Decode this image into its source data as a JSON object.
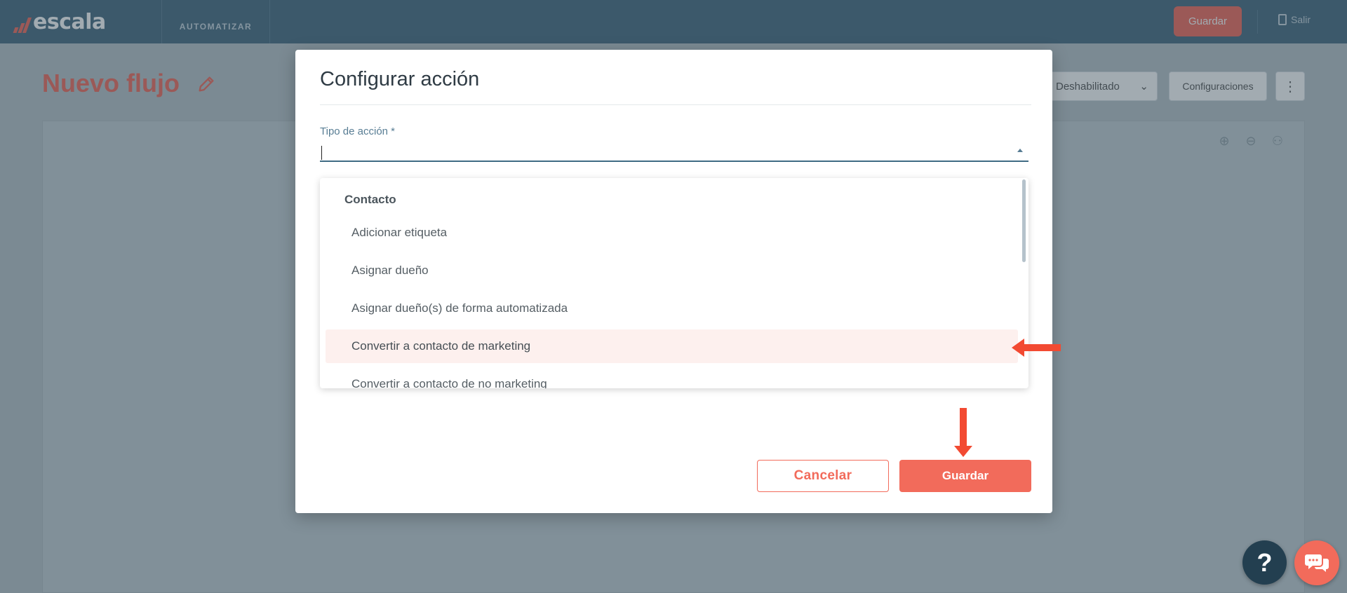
{
  "app": {
    "logo_text": "escala",
    "module_tab": "AUTOMATIZAR",
    "save_label": "Guardar",
    "exit_label": "Salir"
  },
  "page": {
    "title": "Nuevo flujo",
    "status_select": "Deshabilitado",
    "config_label": "Configuraciones",
    "kebab_glyph": "⋮"
  },
  "modal": {
    "title": "Configurar acción",
    "field_label": "Tipo de acción *",
    "field_value": "",
    "dropdown": {
      "group": "Contacto",
      "items": [
        "Adicionar etiqueta",
        "Asignar dueño",
        "Asignar dueño(s) de forma automatizada",
        "Convertir a contacto de marketing",
        "Convertir a contacto de no marketing"
      ],
      "highlighted_index": 3
    },
    "cancel_label": "Cancelar",
    "save_label": "Guardar"
  },
  "floating": {
    "help_glyph": "?"
  },
  "colors": {
    "brand": "#f26b5b",
    "topbar": "#466a80",
    "help": "#233f50",
    "annotation_arrow": "#f24a32"
  },
  "icons": [
    "pencil-icon",
    "chevron-down-icon",
    "exit-icon",
    "zoom-in-icon",
    "zoom-out-icon",
    "user-icon",
    "arrow-left-icon",
    "arrow-down-icon",
    "chat-icon"
  ]
}
